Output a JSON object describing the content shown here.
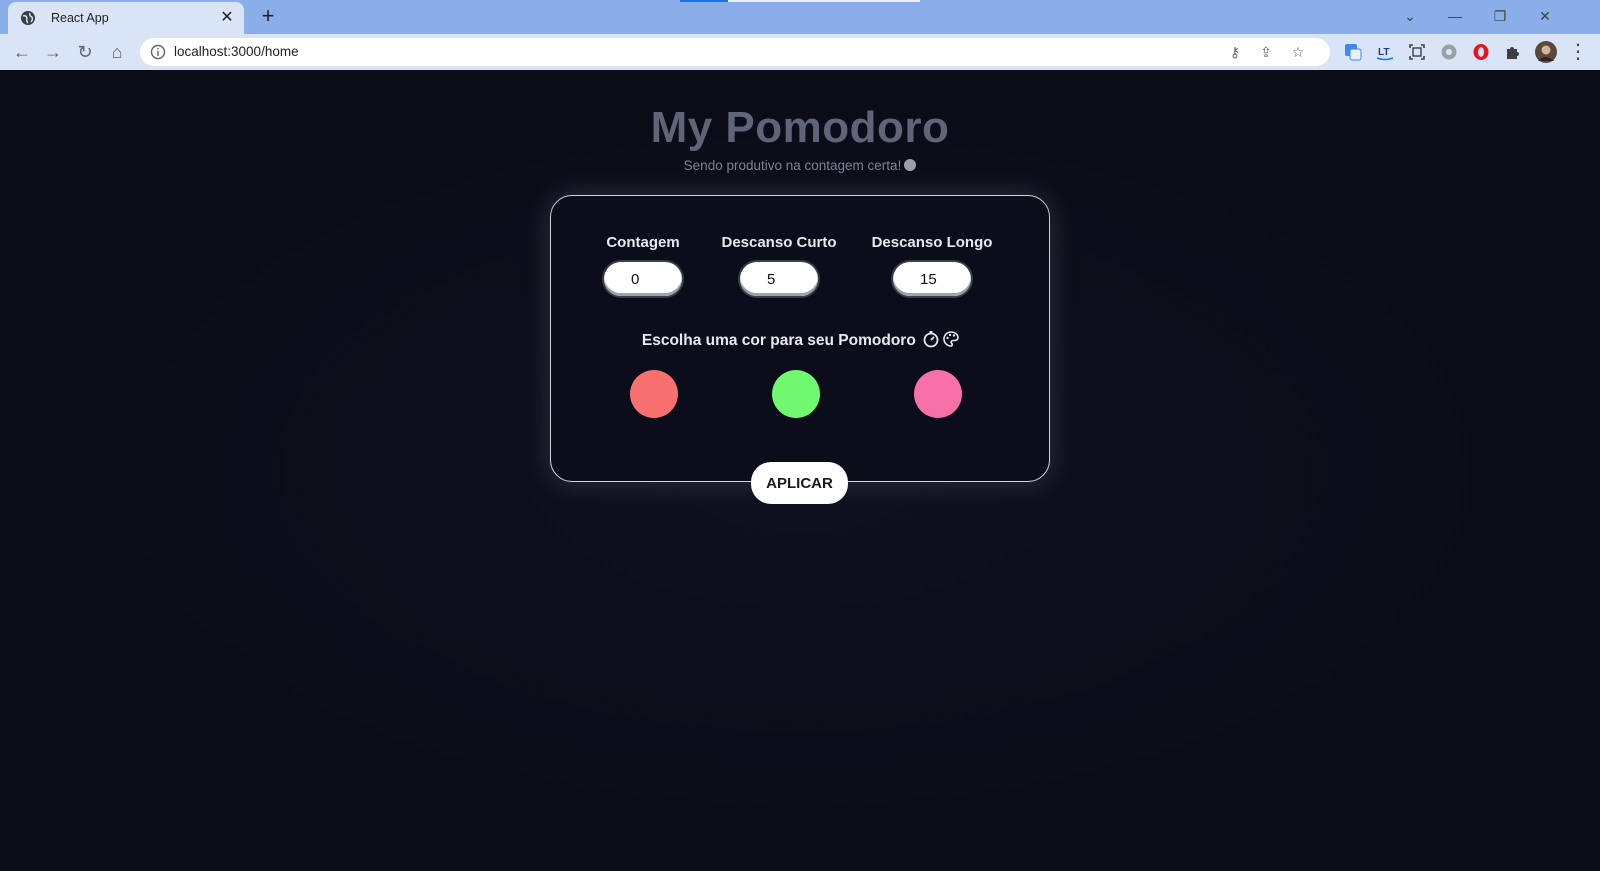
{
  "browser": {
    "tab_title": "React App",
    "tab_close": "✕",
    "new_tab": "+",
    "url": "localhost:3000/home",
    "window_controls": {
      "dropdown": "⌄",
      "minimize": "—",
      "restore": "❐",
      "close": "✕"
    },
    "nav": {
      "back": "←",
      "forward": "→",
      "reload": "↻",
      "home": "⌂"
    },
    "omnibox_icons": {
      "key": "⚷",
      "share": "⇪",
      "bookmark": "☆"
    },
    "menu": "⋮",
    "extensions": [
      "google-translate-icon",
      "lt-extension-icon",
      "screen-capture-icon",
      "settings-extension-icon",
      "opera-icon",
      "puzzle-icon",
      "profile-avatar"
    ]
  },
  "app": {
    "title": "My Pomodoro",
    "subtitle": "Sendo produtivo na contagem certa!",
    "fields": {
      "contagem": {
        "label": "Contagem",
        "value": "0"
      },
      "descanso_curto": {
        "label": "Descanso Curto",
        "value": "5"
      },
      "descanso_longo": {
        "label": "Descanso Longo",
        "value": "15"
      }
    },
    "color_title": "Escolha uma cor para seu Pomodoro",
    "colors": [
      "#f87070",
      "#70f870",
      "#f870a8"
    ],
    "apply_label": "APLICAR"
  }
}
